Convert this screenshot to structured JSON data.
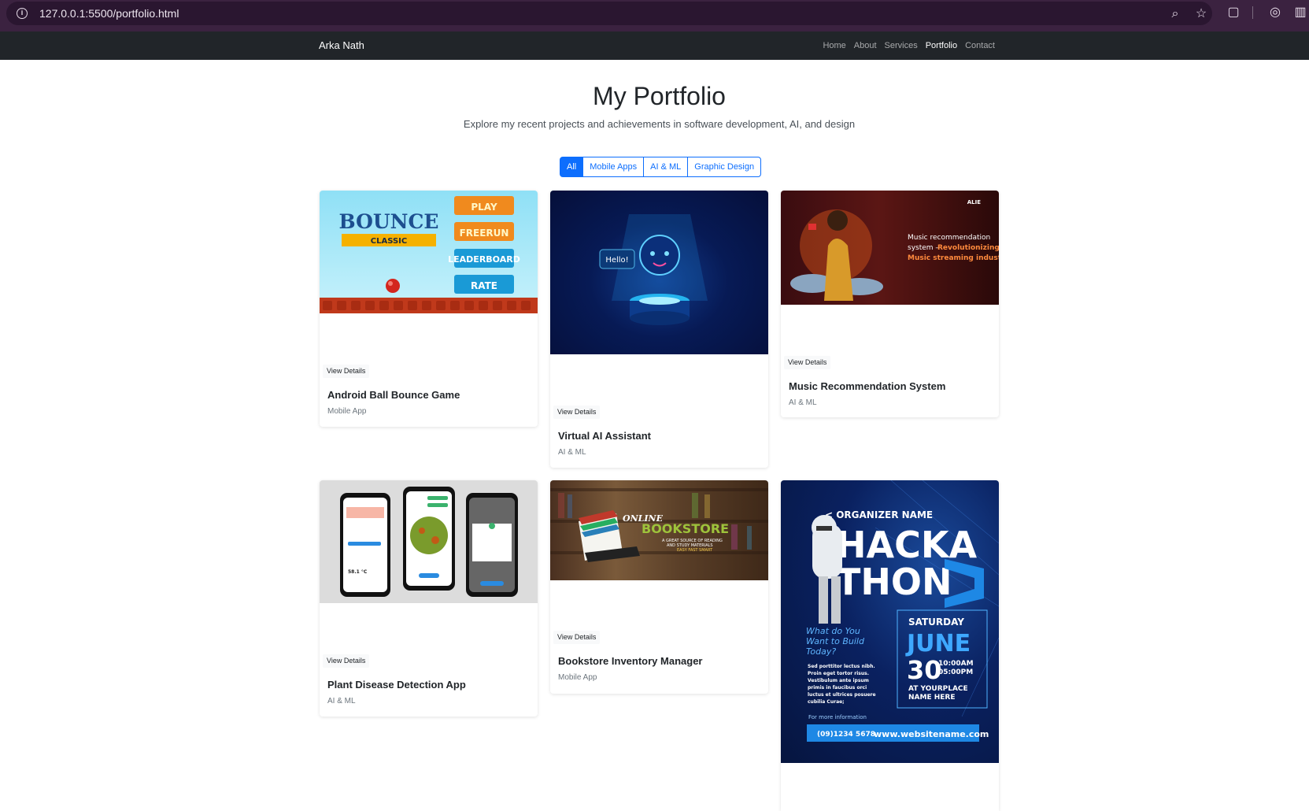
{
  "browser": {
    "url": "127.0.0.1:5500/portfolio.html",
    "icons": [
      "info-icon",
      "zoom-icon",
      "star-icon",
      "extensions-icon",
      "screenshot-icon",
      "sidebar-icon"
    ]
  },
  "navbar": {
    "brand": "Arka Nath",
    "links": [
      "Home",
      "About",
      "Services",
      "Portfolio",
      "Contact"
    ],
    "active": "Portfolio"
  },
  "header": {
    "title": "My Portfolio",
    "subtitle": "Explore my recent projects and achievements in software development, AI, and design"
  },
  "filters": [
    "All",
    "Mobile Apps",
    "AI & ML",
    "Graphic Design"
  ],
  "cards": [
    {
      "title": "Android Ball Bounce Game",
      "category": "Mobile App",
      "button": "View Details",
      "image_text": {
        "logo": "BOUNCE",
        "logo_sub": "CLASSIC",
        "menu": [
          "PLAY",
          "FREERUN",
          "LEADERBOARD",
          "RATE"
        ]
      }
    },
    {
      "title": "Virtual AI Assistant",
      "category": "AI & ML",
      "button": "View Details",
      "image_text": {
        "bubble": "Hello!"
      }
    },
    {
      "title": "Music Recommendation System",
      "category": "AI & ML",
      "button": "View Details",
      "image_text": {
        "brand": "ALIE",
        "line1": "Music recommendation",
        "line2": "system – ",
        "highlight": "Revolutionizing",
        "line3": "Music streaming industry"
      }
    },
    {
      "title": "Plant Disease Detection App",
      "category": "AI & ML",
      "button": "View Details",
      "image_text": {
        "reading": "58.1 °C"
      }
    },
    {
      "title": "Bookstore Inventory Manager",
      "category": "Mobile App",
      "button": "View Details",
      "image_text": {
        "online": "ONLINE",
        "store": "BOOKSTORE",
        "tag1": "A GREAT SOURCE OF READING",
        "tag2": "AND STUDY MATERIALS",
        "tag3": "EASY FAST SMART"
      }
    },
    {
      "title": "",
      "category": "",
      "button": "",
      "image_text": {
        "organizer": "< ORGANIZER NAME",
        "title1": "HACKA",
        "title2": "THON",
        "question": "What do You Want to Build Today?",
        "body": "Sed porttitor lectus nibh. Proin eget tortor risus. Vestibulum ante ipsum primis in faucibus orci luctus et ultrices posuere cubilia Curae;",
        "day": "SATURDAY",
        "month": "JUNE",
        "date": "30",
        "time1": "10:00AM",
        "time2": "05:00PM",
        "place1": "AT YOURPLACE",
        "place2": "NAME HERE",
        "more": "For more information",
        "phone": "(09)1234 5678",
        "website": "www.websitename.com"
      }
    }
  ]
}
